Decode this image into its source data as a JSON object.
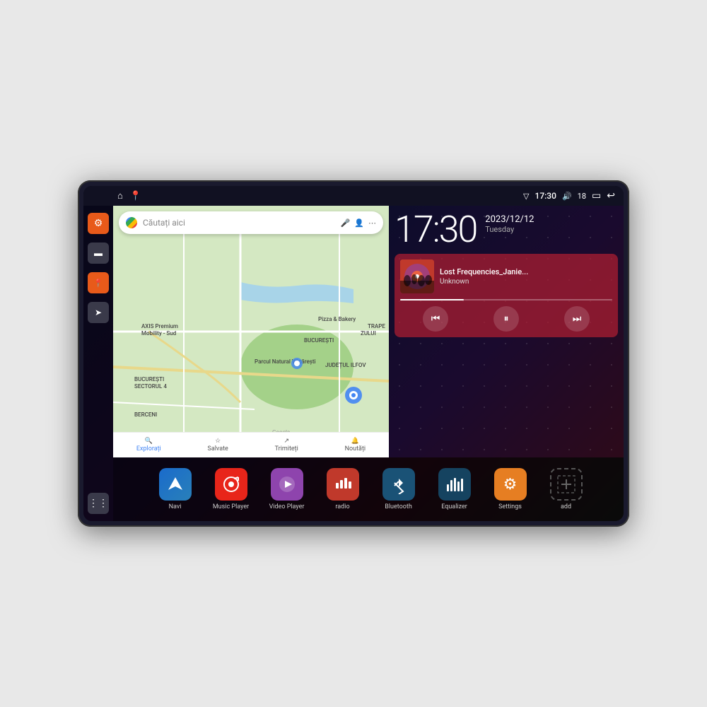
{
  "device": {
    "status_bar": {
      "wifi_icon": "▼",
      "time": "17:30",
      "volume_icon": "🔊",
      "battery_level": "18",
      "battery_icon": "▭",
      "back_icon": "↩"
    },
    "sidebar": {
      "buttons": [
        {
          "id": "settings",
          "icon": "⚙",
          "color": "orange"
        },
        {
          "id": "files",
          "icon": "▭",
          "color": "dark"
        },
        {
          "id": "maps",
          "icon": "📍",
          "color": "orange"
        },
        {
          "id": "navigation",
          "icon": "➤",
          "color": "dark"
        }
      ]
    },
    "map": {
      "search_placeholder": "Căutați aici",
      "bottom_items": [
        {
          "label": "Explorați",
          "icon": "🔍",
          "active": true
        },
        {
          "label": "Salvate",
          "icon": "☆",
          "active": false
        },
        {
          "label": "Trimiteți",
          "icon": "↗",
          "active": false
        },
        {
          "label": "Noutăți",
          "icon": "🔔",
          "active": false
        }
      ],
      "places": [
        "AXIS Premium Mobility - Sud",
        "Pizza & Bakery",
        "Parcul Natural Văcărești",
        "BUCUREȘTI SECTORUL 4",
        "BUCUREȘTI",
        "JUDEȚUL ILFOV",
        "BERCENI",
        "TRAPEZULUI"
      ]
    },
    "clock": {
      "time": "17:30",
      "year": "2023/12/12",
      "weekday": "Tuesday"
    },
    "music_player": {
      "song_title": "Lost Frequencies_Janie...",
      "artist": "Unknown",
      "progress": 30
    },
    "apps": [
      {
        "id": "navi",
        "label": "Navi",
        "icon": "➤",
        "color": "blue"
      },
      {
        "id": "music-player",
        "label": "Music Player",
        "icon": "♪",
        "color": "red"
      },
      {
        "id": "video-player",
        "label": "Video Player",
        "icon": "▶",
        "color": "purple"
      },
      {
        "id": "radio",
        "label": "radio",
        "icon": "📶",
        "color": "dark-red"
      },
      {
        "id": "bluetooth",
        "label": "Bluetooth",
        "icon": "⚡",
        "color": "blue"
      },
      {
        "id": "equalizer",
        "label": "Equalizer",
        "icon": "≡",
        "color": "dark-blue"
      },
      {
        "id": "settings",
        "label": "Settings",
        "icon": "⚙",
        "color": "orange2"
      },
      {
        "id": "add",
        "label": "add",
        "icon": "+",
        "color": "outlined"
      }
    ],
    "player_controls": {
      "prev": "⏮",
      "play_pause": "⏸",
      "next": "⏭"
    }
  }
}
